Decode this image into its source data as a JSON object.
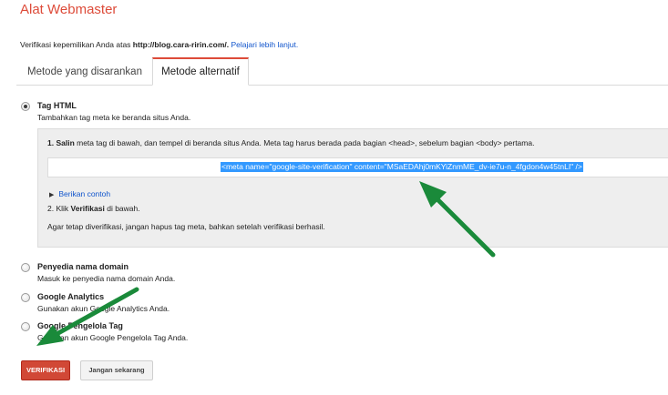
{
  "header": {
    "title": "Alat Webmaster"
  },
  "verification": {
    "text_before": "Verifikasi kepemilikan Anda atas ",
    "site_url": "http://blog.cara-ririn.com/.",
    "learn_more": "Pelajari lebih lanjut."
  },
  "tabs": [
    {
      "label": "Metode yang disarankan",
      "active": false
    },
    {
      "label": "Metode alternatif",
      "active": true
    }
  ],
  "methods": {
    "html_tag": {
      "title": "Tag HTML",
      "desc": "Tambahkan tag meta ke beranda situs Anda.",
      "selected": true,
      "step1_bold": "1. Salin",
      "step1_text": " meta tag di bawah, dan tempel di beranda situs Anda. Meta tag harus berada pada bagian <head>, sebelum bagian <body> pertama.",
      "meta_tag": "<meta name=\"google-site-verification\" content=\"MSaEDAhj0mKYiZnmME_dv-ie7u-n_4fgdon4w45tnLI\" />",
      "example_link": "Berikan contoh",
      "step2_prefix": "2. Klik ",
      "step2_bold": "Verifikasi",
      "step2_suffix": " di bawah.",
      "keep_note": "Agar tetap diverifikasi, jangan hapus tag meta, bahkan setelah verifikasi berhasil."
    },
    "domain_provider": {
      "title": "Penyedia nama domain",
      "desc": "Masuk ke penyedia nama domain Anda."
    },
    "google_analytics": {
      "title": "Google Analytics",
      "desc": "Gunakan akun Google Analytics Anda."
    },
    "tag_manager": {
      "title": "Google Pengelola Tag",
      "desc": "Gunakan akun Google Pengelola Tag Anda."
    }
  },
  "buttons": {
    "verify": "VERIFIKASI",
    "later": "Jangan sekarang"
  },
  "colors": {
    "brand": "#dd4b39",
    "link": "#1155cc",
    "verify_button": "#d14836",
    "arrow": "#1a8a3a",
    "selection": "#3399ff"
  }
}
